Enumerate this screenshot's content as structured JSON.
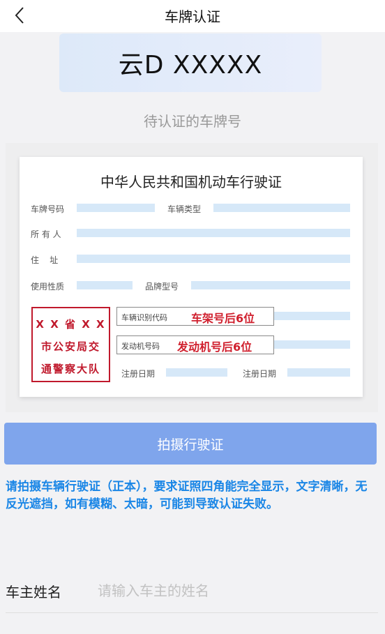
{
  "nav": {
    "title": "车牌认证"
  },
  "plate": {
    "number": "云D XXXXX",
    "subtitle": "待认证的车牌号"
  },
  "license": {
    "title": "中华人民共和国机动车行驶证",
    "labels": {
      "plate_no": "车牌号码",
      "vehicle_type": "车辆类型",
      "owner": "所 有 人",
      "address": "住    址",
      "use_nature": "使用性质",
      "brand_model": "品牌型号",
      "vin": "车辆识别代码",
      "engine_no": "发动机号码",
      "register_date": "注册日期",
      "issue_date": "注册日期"
    },
    "highlights": {
      "vin": "车架号后6位",
      "engine": "发动机号后6位"
    },
    "stamp": [
      "X X 省 X X",
      "市公安局交",
      "通警察大队"
    ]
  },
  "capture_button": "拍摄行驶证",
  "notice": "请拍摄车辆行驶证（正本），要求证照四角能完全显示，文字清晰，无反光遮挡，如有模糊、太暗，可能到导致认证失败。",
  "form": {
    "owner_label": "车主姓名",
    "owner_placeholder": "请输入车主的姓名",
    "owner_value": ""
  },
  "colors": {
    "accent": "#7fa5ec",
    "notice": "#1a86e6",
    "stamp": "#c0192c"
  }
}
